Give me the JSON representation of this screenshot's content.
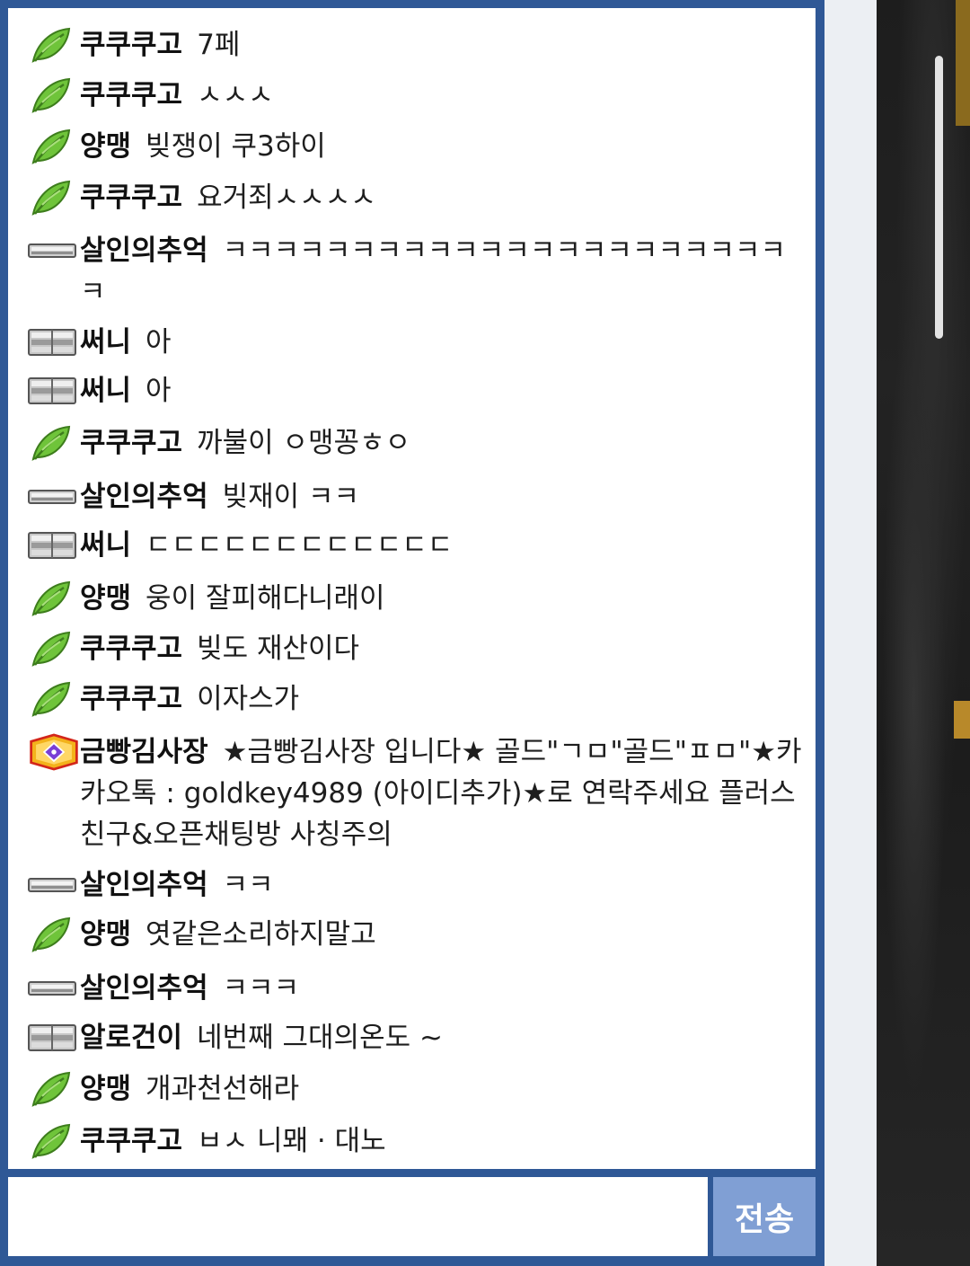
{
  "chat": {
    "messages": [
      {
        "badge": "leaf-icon",
        "nick": "쿠쿠쿠고",
        "text": "7페"
      },
      {
        "badge": "leaf-icon",
        "nick": "쿠쿠쿠고",
        "text": "ㅅㅅㅅ"
      },
      {
        "badge": "leaf-icon",
        "nick": "양맹",
        "text": "빚쟁이 쿠3하이"
      },
      {
        "badge": "leaf-icon",
        "nick": "쿠쿠쿠고",
        "text": "요거죄ㅅㅅㅅㅅ"
      },
      {
        "badge": "gray-bar-icon",
        "nick": "살인의추억",
        "text": "ㅋㅋㅋㅋㅋㅋㅋㅋㅋㅋㅋㅋㅋㅋㅋㅋㅋㅋㅋㅋㅋㅋㅋ"
      },
      {
        "badge": "gray-stack-icon",
        "nick": "써니",
        "text": "아"
      },
      {
        "badge": "gray-stack-icon",
        "nick": "써니",
        "text": "아"
      },
      {
        "badge": "leaf-icon",
        "nick": "쿠쿠쿠고",
        "text": "까불이 ㅇ맹꽁ㅎㅇ"
      },
      {
        "badge": "gray-bar-icon",
        "nick": "살인의추억",
        "text": "빚재이 ㅋㅋ"
      },
      {
        "badge": "gray-stack-icon",
        "nick": "써니",
        "text": "ㄷㄷㄷㄷㄷㄷㄷㄷㄷㄷㄷㄷ"
      },
      {
        "badge": "leaf-icon",
        "nick": "양맹",
        "text": "웅이 잘피해다니래이"
      },
      {
        "badge": "leaf-icon",
        "nick": "쿠쿠쿠고",
        "text": "빚도 재산이다"
      },
      {
        "badge": "leaf-icon",
        "nick": "쿠쿠쿠고",
        "text": "이자스가"
      },
      {
        "badge": "gold-gem-icon",
        "nick": "금빵김사장",
        "text": "★금빵김사장 입니다★ 골드\"ㄱㅁ\"골드\"ㅍㅁ\"★카카오톡 : goldkey4989 (아이디추가)★로 연락주세요 플러스친구&오픈채팅방 사칭주의"
      },
      {
        "badge": "gray-bar-icon",
        "nick": "살인의추억",
        "text": "ㅋㅋ"
      },
      {
        "badge": "leaf-icon",
        "nick": "양맹",
        "text": "엿같은소리하지말고"
      },
      {
        "badge": "gray-bar-icon",
        "nick": "살인의추억",
        "text": "ㅋㅋㅋ"
      },
      {
        "badge": "gray-stack-icon",
        "nick": "알로건이",
        "text": "네번째 그대의온도 ~"
      },
      {
        "badge": "leaf-icon",
        "nick": "양맹",
        "text": "개과천선해라"
      },
      {
        "badge": "leaf-icon",
        "nick": "쿠쿠쿠고",
        "text": "ㅂㅅ 니뫠 · 대노"
      }
    ]
  },
  "composer": {
    "input_value": "",
    "send_label": "전송"
  },
  "colors": {
    "frame": "#2f5896",
    "send_button": "#809fd4"
  }
}
